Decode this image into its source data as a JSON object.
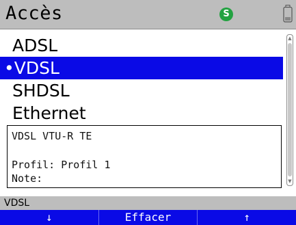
{
  "header": {
    "title": "Accès",
    "status_badge": "S",
    "battery_icon": "battery-icon"
  },
  "menu": {
    "items": [
      {
        "label": "ADSL",
        "selected": false
      },
      {
        "label": "•VDSL",
        "selected": true
      },
      {
        "label": "SHDSL",
        "selected": false
      },
      {
        "label": "Ethernet",
        "selected": false
      }
    ]
  },
  "details": {
    "line1": "VDSL VTU-R TE",
    "line2": "Profil: Profil 1",
    "line3": "Note:"
  },
  "status_bar": {
    "text": "VDSL"
  },
  "softkeys": [
    {
      "label": "↓"
    },
    {
      "label": "Effacer"
    },
    {
      "label": "↑"
    }
  ],
  "colors": {
    "selection": "#0a0ae6",
    "header_bg": "#bdbdbd",
    "status_green": "#23a241"
  }
}
